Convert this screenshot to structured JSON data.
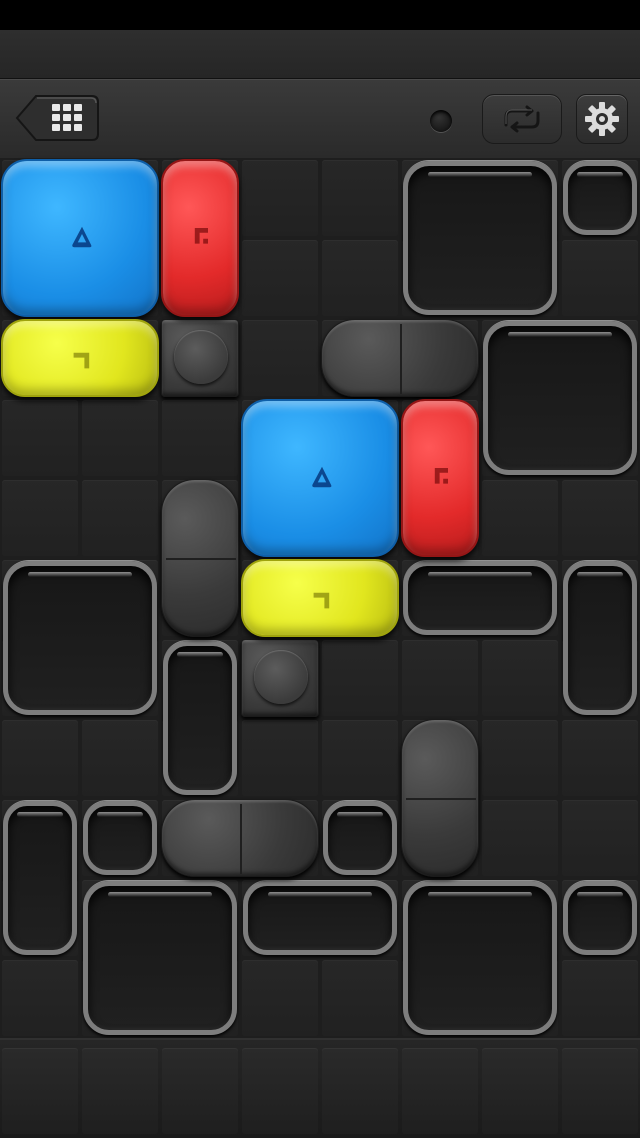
{
  "toolbar": {
    "back_icon": "grid-menu-icon",
    "indicator_icon": "dot-indicator",
    "repeat_icon": "repeat-icon",
    "settings_icon": "gear-icon"
  },
  "colors": {
    "blue": "#1a8ee6",
    "red": "#e32a2a",
    "yellow": "#e1e61e",
    "frame": "#7d7d7d",
    "stone": "#3a3a3a",
    "background": "#1e1e1e"
  },
  "board": {
    "columns": 8,
    "rows": 11,
    "jellies": [
      {
        "color": "blue",
        "col": 0,
        "row": 0,
        "w": 2,
        "h": 2,
        "symbol": "triangle"
      },
      {
        "color": "red",
        "col": 2,
        "row": 0,
        "w": 1,
        "h": 2,
        "symbol": "corner"
      },
      {
        "color": "yellow",
        "col": 0,
        "row": 2,
        "w": 2,
        "h": 1,
        "symbol": "hook"
      },
      {
        "color": "blue",
        "col": 3,
        "row": 3,
        "w": 2,
        "h": 2,
        "symbol": "triangle"
      },
      {
        "color": "red",
        "col": 5,
        "row": 3,
        "w": 1,
        "h": 2,
        "symbol": "corner"
      },
      {
        "color": "yellow",
        "col": 3,
        "row": 5,
        "w": 2,
        "h": 1,
        "symbol": "hook"
      }
    ],
    "stones": [
      {
        "col": 2,
        "row": 2,
        "w": 1,
        "h": 1
      },
      {
        "col": 4,
        "row": 2,
        "w": 2,
        "h": 1
      },
      {
        "col": 2,
        "row": 4,
        "w": 1,
        "h": 2
      },
      {
        "col": 3,
        "row": 6,
        "w": 1,
        "h": 1
      },
      {
        "col": 5,
        "row": 7,
        "w": 1,
        "h": 2
      },
      {
        "col": 2,
        "row": 8,
        "w": 2,
        "h": 1
      }
    ],
    "holes": [
      {
        "col": 5,
        "row": 0,
        "w": 2,
        "h": 2
      },
      {
        "col": 7,
        "row": 0,
        "w": 1,
        "h": 1
      },
      {
        "col": 6,
        "row": 2,
        "w": 2,
        "h": 2
      },
      {
        "col": 0,
        "row": 5,
        "w": 2,
        "h": 2
      },
      {
        "col": 5,
        "row": 5,
        "w": 2,
        "h": 1
      },
      {
        "col": 7,
        "row": 5,
        "w": 1,
        "h": 2
      },
      {
        "col": 2,
        "row": 6,
        "w": 1,
        "h": 2
      },
      {
        "col": 0,
        "row": 8,
        "w": 1,
        "h": 2
      },
      {
        "col": 1,
        "row": 8,
        "w": 1,
        "h": 1
      },
      {
        "col": 4,
        "row": 8,
        "w": 1,
        "h": 1
      },
      {
        "col": 1,
        "row": 9,
        "w": 2,
        "h": 2
      },
      {
        "col": 3,
        "row": 9,
        "w": 2,
        "h": 1
      },
      {
        "col": 5,
        "row": 9,
        "w": 2,
        "h": 2
      },
      {
        "col": 7,
        "row": 9,
        "w": 1,
        "h": 1
      }
    ]
  }
}
